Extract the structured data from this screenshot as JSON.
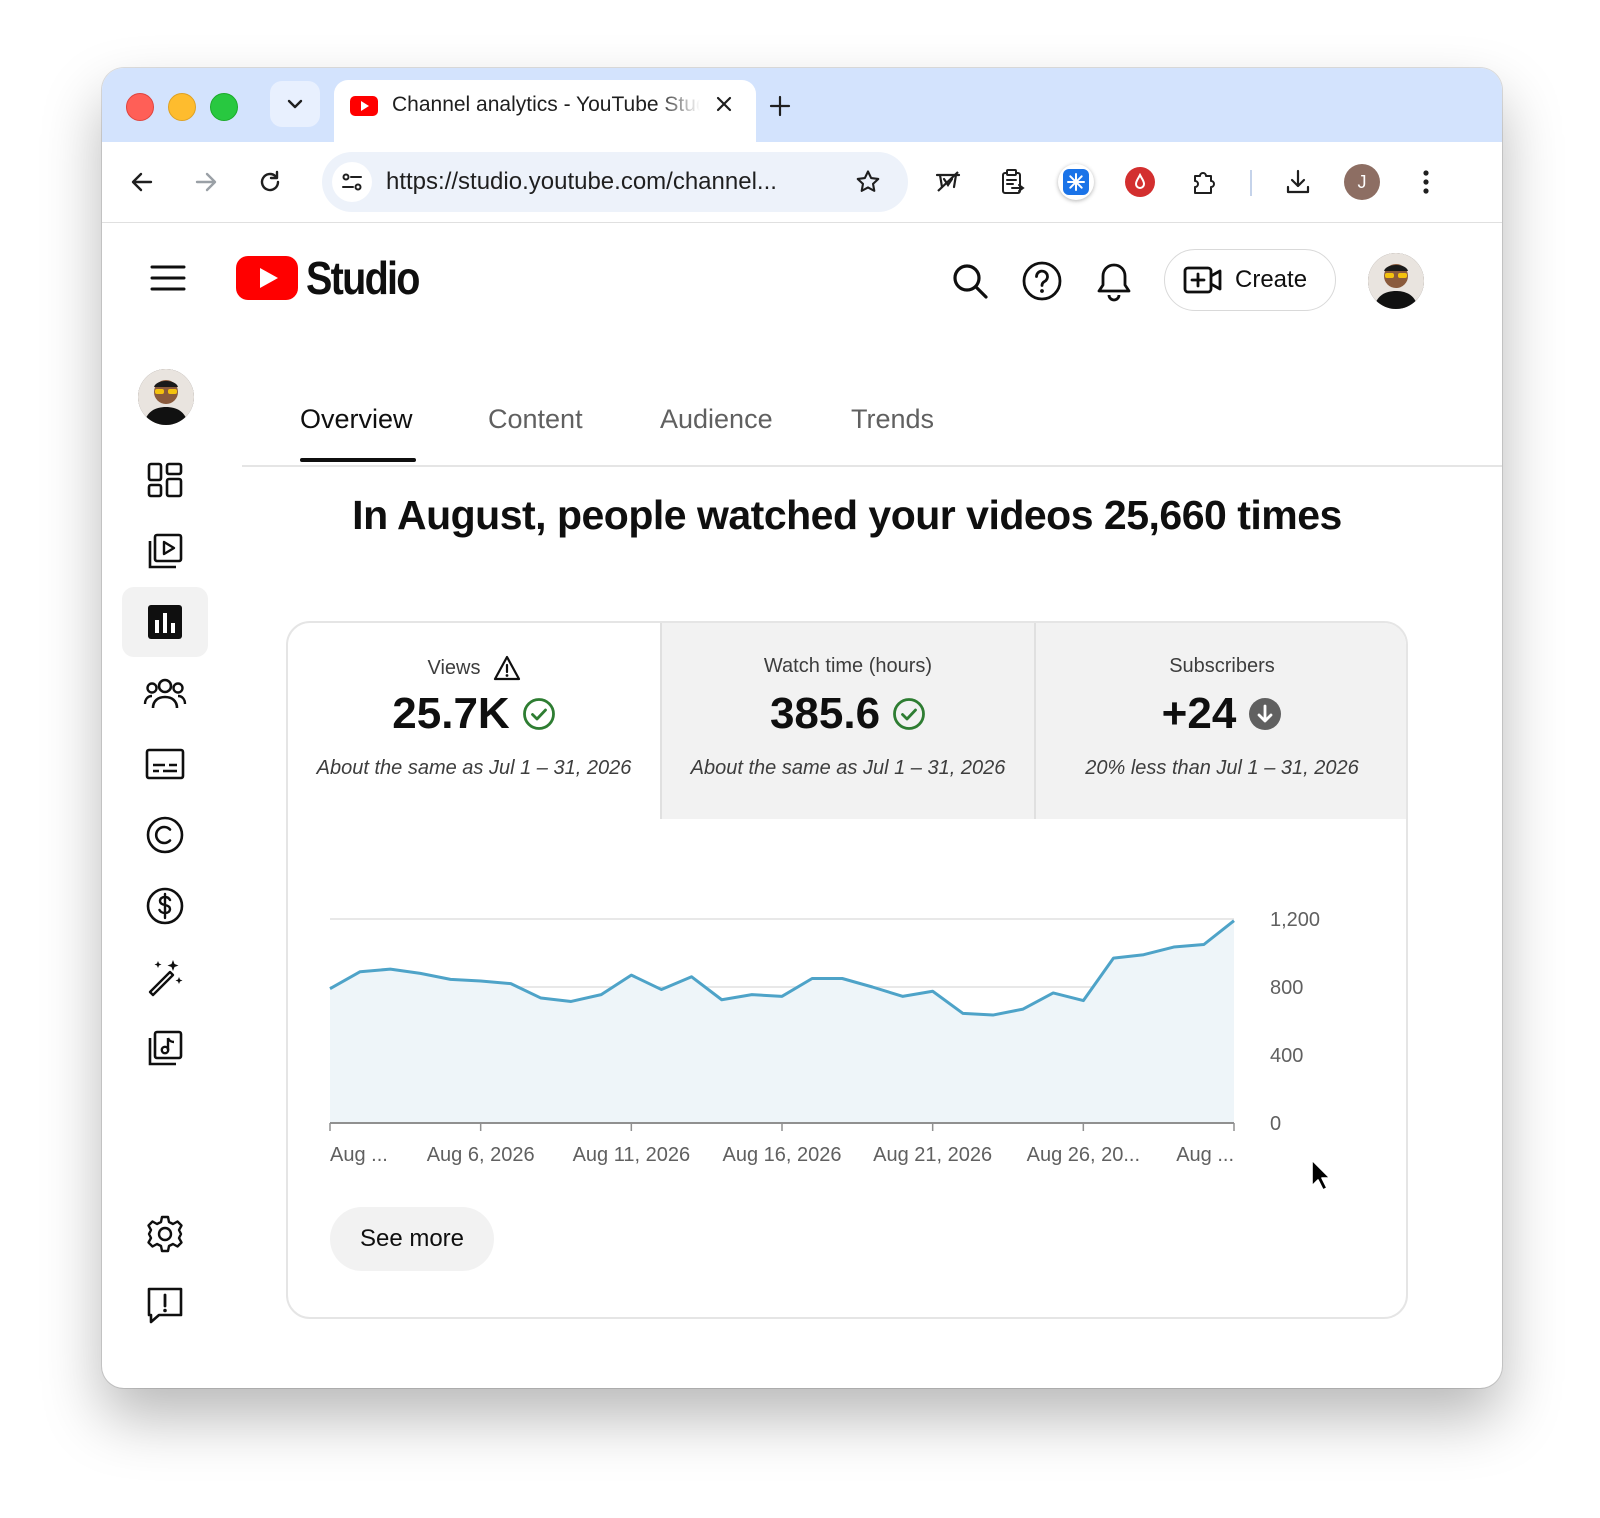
{
  "browser": {
    "tab_title": "Channel analytics - YouTube Studio",
    "url": "https://studio.youtube.com/channel...",
    "profile_initial": "J"
  },
  "studio": {
    "logo_text": "Studio",
    "create_label": "Create"
  },
  "nav_tabs": [
    "Overview",
    "Content",
    "Audience",
    "Trends"
  ],
  "headline": "In August, people watched your videos 25,660 times",
  "metrics": [
    {
      "label": "Views",
      "value": "25.7K",
      "comparison": "About the same as Jul 1 – 31, 2026",
      "status": "check"
    },
    {
      "label": "Watch time (hours)",
      "value": "385.6",
      "comparison": "About the same as Jul 1 – 31, 2026",
      "status": "check"
    },
    {
      "label": "Subscribers",
      "value": "+24",
      "comparison": "20% less than Jul 1 – 31, 2026",
      "status": "down"
    }
  ],
  "see_more_label": "See more",
  "colors": {
    "line": "#4ea3c8",
    "fill": "#eef5f9",
    "check": "#2e7d32",
    "accent_red": "#ff0000"
  },
  "chart_data": {
    "type": "area",
    "x": [
      "Aug 1, 2026",
      "Aug 2, 2026",
      "Aug 3, 2026",
      "Aug 4, 2026",
      "Aug 5, 2026",
      "Aug 6, 2026",
      "Aug 7, 2026",
      "Aug 8, 2026",
      "Aug 9, 2026",
      "Aug 10, 2026",
      "Aug 11, 2026",
      "Aug 12, 2026",
      "Aug 13, 2026",
      "Aug 14, 2026",
      "Aug 15, 2026",
      "Aug 16, 2026",
      "Aug 17, 2026",
      "Aug 18, 2026",
      "Aug 19, 2026",
      "Aug 20, 2026",
      "Aug 21, 2026",
      "Aug 22, 2026",
      "Aug 23, 2026",
      "Aug 24, 2026",
      "Aug 25, 2026",
      "Aug 26, 2026",
      "Aug 27, 2026",
      "Aug 28, 2026",
      "Aug 29, 2026",
      "Aug 30, 2026",
      "Aug 31, 2026"
    ],
    "series": [
      {
        "values": [
          790,
          890,
          905,
          880,
          845,
          835,
          820,
          735,
          715,
          755,
          870,
          785,
          860,
          725,
          755,
          745,
          850,
          850,
          800,
          745,
          775,
          645,
          635,
          670,
          765,
          720,
          970,
          990,
          1035,
          1050,
          1190
        ]
      }
    ],
    "x_tick_labels": [
      "Aug ...",
      "Aug 6, 2026",
      "Aug 11, 2026",
      "Aug 16, 2026",
      "Aug 21, 2026",
      "Aug 26, 20...",
      "Aug ..."
    ],
    "y_tick_labels": [
      "0",
      "400",
      "800",
      "1,200"
    ],
    "y_ticks": [
      0,
      400,
      800,
      1200
    ],
    "ylim": [
      0,
      1200
    ],
    "grid": true,
    "y_axis_side": "right"
  }
}
